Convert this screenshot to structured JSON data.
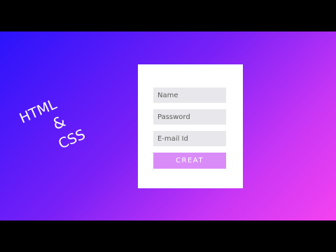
{
  "handwritten_title": {
    "line1": "HTML",
    "line2": "&",
    "line3": "CSS"
  },
  "form": {
    "name_placeholder": "Name",
    "password_placeholder": "Password",
    "email_placeholder": "E-mail Id",
    "submit_label": "CREAT"
  },
  "colors": {
    "gradient_start": "#2a13fb",
    "gradient_end": "#f542f0",
    "card_background": "#ffffff",
    "input_background": "#e8e8ec",
    "button_background": "#d98cf7",
    "letterbox": "#000000"
  }
}
